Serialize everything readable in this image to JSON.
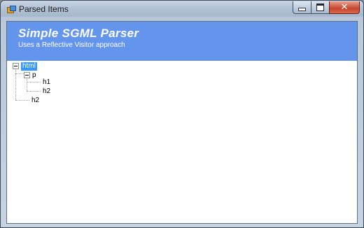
{
  "window": {
    "title": "Parsed Items",
    "controls": {
      "minimize_icon": "minimize-icon",
      "maximize_icon": "maximize-icon",
      "close_icon": "close-icon"
    }
  },
  "banner": {
    "title": "Simple SGML Parser",
    "subtitle": "Uses a Reflective Visitor approach",
    "color": "#6495ed"
  },
  "tree": {
    "nodes": [
      {
        "label": "html",
        "selected": true,
        "expanded": true
      },
      {
        "label": "p",
        "expanded": true
      },
      {
        "label": "h1"
      },
      {
        "label": "h2"
      },
      {
        "label": "h2"
      }
    ],
    "selection_color": "#3399ff"
  }
}
